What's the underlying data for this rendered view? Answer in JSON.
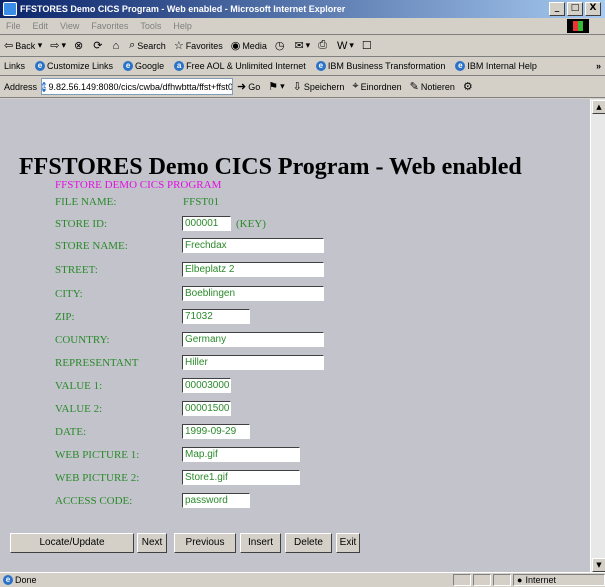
{
  "window": {
    "title": "FFSTORES Demo CICS Program - Web enabled - Microsoft Internet Explorer",
    "min": "_",
    "max": "□",
    "close": "X"
  },
  "menu": [
    "File",
    "Edit",
    "View",
    "Favorites",
    "Tools",
    "Help"
  ],
  "toolbar": {
    "back": "Back",
    "search": "Search",
    "favorites": "Favorites",
    "media": "Media"
  },
  "links": {
    "label": "Links",
    "items": [
      "Customize Links",
      "Google",
      "Free AOL & Unlimited Internet",
      "IBM Business Transformation",
      "IBM Internal Help"
    ],
    "more": "»"
  },
  "address": {
    "label": "Address",
    "url": "9.82.56.149:8080/cics/cwba/dfhwbtta/ffst+ffst01",
    "go": "Go",
    "speichern": "Speichern",
    "einordnen": "Einordnen",
    "notieren": "Notieren"
  },
  "page": {
    "heading": "FFSTORES Demo CICS Program - Web enabled",
    "subtitle": "FFSTORE DEMO CICS PROGRAM",
    "file_name_label": "FILE NAME:",
    "file_name_value": "FFST01",
    "key_label": "(KEY)",
    "fields": [
      {
        "label": "STORE ID:",
        "value": "000001"
      },
      {
        "label": "STORE NAME:",
        "value": "Frechdax"
      },
      {
        "label": "STREET:",
        "value": "Elbeplatz 2"
      },
      {
        "label": "CITY:",
        "value": "Boeblingen"
      },
      {
        "label": "ZIP:",
        "value": "71032"
      },
      {
        "label": "COUNTRY:",
        "value": "Germany"
      },
      {
        "label": "REPRESENTANT",
        "value": "Hiller"
      },
      {
        "label": "VALUE 1:",
        "value": "00003000"
      },
      {
        "label": "VALUE 2:",
        "value": "00001500"
      },
      {
        "label": "DATE:",
        "value": "1999-09-29"
      },
      {
        "label": "WEB PICTURE 1:",
        "value": "Map.gif"
      },
      {
        "label": "WEB PICTURE 2:",
        "value": "Store1.gif"
      },
      {
        "label": "ACCESS CODE:",
        "value": "password"
      }
    ],
    "buttons": [
      "Locate/Update",
      "Next",
      "Previous",
      "Insert",
      "Delete",
      "Exit"
    ]
  },
  "status": {
    "text": "Done",
    "zone": "Internet"
  }
}
